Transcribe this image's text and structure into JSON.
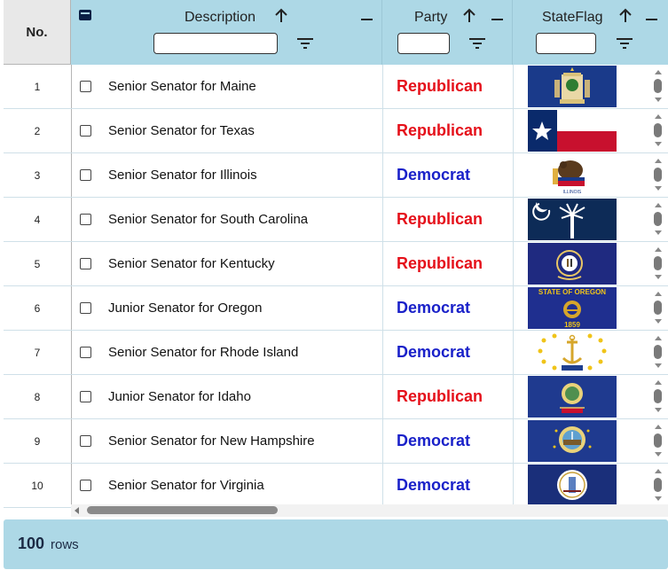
{
  "columns": {
    "no": "No.",
    "description": "Description",
    "party": "Party",
    "flag": "StateFlag"
  },
  "filters": {
    "description": "",
    "party": "",
    "flag": ""
  },
  "colors": {
    "header_bg": "#add8e6",
    "republican": "#e5101a",
    "democrat": "#1a21c9"
  },
  "rows": [
    {
      "no": "1",
      "description": "Senior Senator for Maine",
      "party": "Republican",
      "flag": "maine-flag"
    },
    {
      "no": "2",
      "description": "Senior Senator for Texas",
      "party": "Republican",
      "flag": "texas-flag"
    },
    {
      "no": "3",
      "description": "Senior Senator for Illinois",
      "party": "Democrat",
      "flag": "illinois-flag",
      "flag_text": "ILLINOIS"
    },
    {
      "no": "4",
      "description": "Senior Senator for South Carolina",
      "party": "Republican",
      "flag": "south-carolina-flag"
    },
    {
      "no": "5",
      "description": "Senior Senator for Kentucky",
      "party": "Republican",
      "flag": "kentucky-flag"
    },
    {
      "no": "6",
      "description": "Junior Senator for Oregon",
      "party": "Democrat",
      "flag": "oregon-flag",
      "flag_text": "STATE OF OREGON",
      "flag_year": "1859"
    },
    {
      "no": "7",
      "description": "Senior Senator for Rhode Island",
      "party": "Democrat",
      "flag": "rhode-island-flag"
    },
    {
      "no": "8",
      "description": "Junior Senator for Idaho",
      "party": "Republican",
      "flag": "idaho-flag"
    },
    {
      "no": "9",
      "description": "Senior Senator for New Hampshire",
      "party": "Democrat",
      "flag": "new-hampshire-flag"
    },
    {
      "no": "10",
      "description": "Senior Senator for Virginia",
      "party": "Democrat",
      "flag": "virginia-flag"
    }
  ],
  "footer": {
    "count": "100",
    "label": "rows"
  }
}
